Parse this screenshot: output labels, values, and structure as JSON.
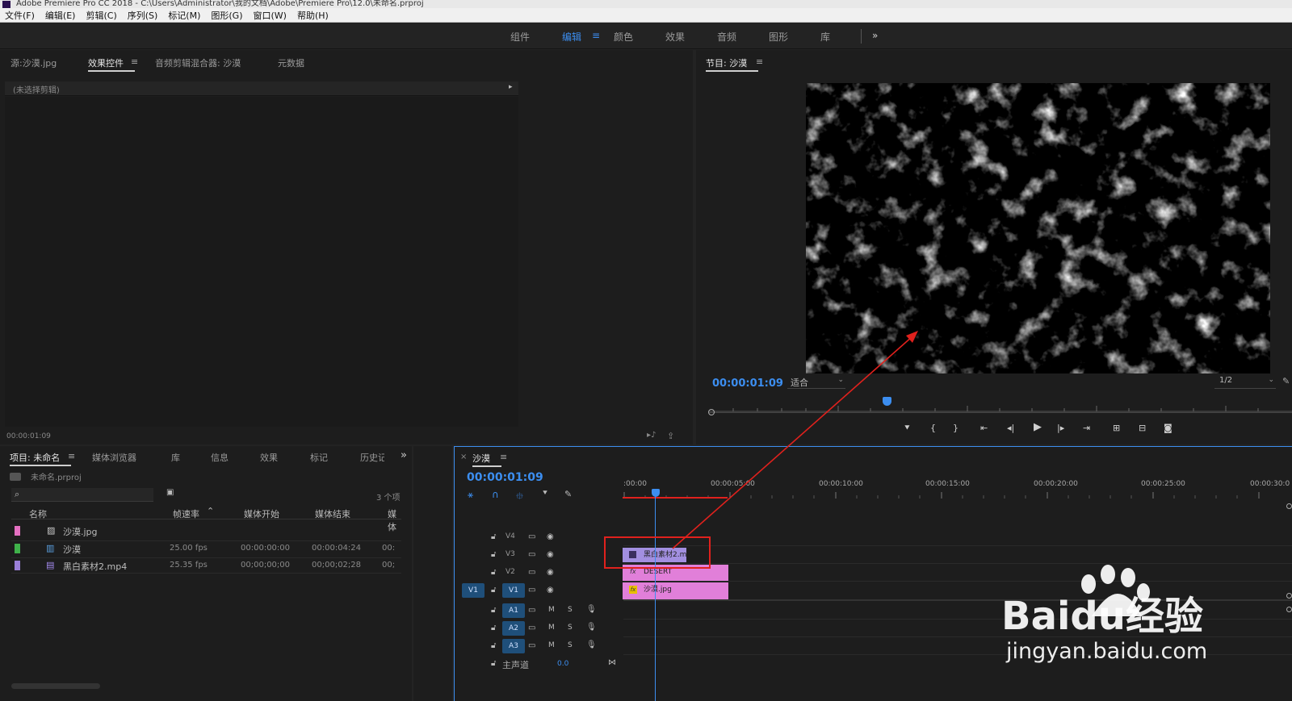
{
  "window": {
    "title": "Adobe Premiere Pro CC 2018 - C:\\Users\\Administrator\\我的文档\\Adobe\\Premiere Pro\\12.0\\未命名.prproj"
  },
  "menu": [
    "文件(F)",
    "编辑(E)",
    "剪辑(C)",
    "序列(S)",
    "标记(M)",
    "图形(G)",
    "窗口(W)",
    "帮助(H)"
  ],
  "workspaces": {
    "items": [
      "组件",
      "编辑",
      "颜色",
      "效果",
      "音频",
      "图形",
      "库"
    ],
    "active": "编辑",
    "more": "»"
  },
  "source_panel": {
    "tabs": [
      "源:沙漠.jpg",
      "效果控件",
      "音频剪辑混合器: 沙漠",
      "元数据"
    ],
    "active_tab": "效果控件",
    "no_clip": "(未选择剪辑)",
    "timecode": "00:00:01:09"
  },
  "program_monitor": {
    "title": "节目: 沙漠",
    "timecode": "00:00:01:09",
    "fit": "适合",
    "resolution": "1/2"
  },
  "project_panel": {
    "tabs": [
      "项目: 未命名",
      "媒体浏览器",
      "库",
      "信息",
      "效果",
      "标记",
      "历史记"
    ],
    "active_tab": "项目: 未命名",
    "file": "未命名.prproj",
    "search_placeholder": "",
    "count": "3 个项",
    "columns": [
      "名称",
      "帧速率",
      "媒体开始",
      "媒体结束",
      "媒体"
    ],
    "rows": [
      {
        "name": "沙漠.jpg",
        "fps": "",
        "start": "",
        "end": "",
        "more": "",
        "color": "#e36fc0",
        "icon": "image-icon"
      },
      {
        "name": "沙漠",
        "fps": "25.00 fps",
        "start": "00:00:00:00",
        "end": "00:00:04:24",
        "more": "00:",
        "color": "#3fb24a",
        "icon": "sequence-icon"
      },
      {
        "name": "黑白素材2.mp4",
        "fps": "25.35 fps",
        "start": "00;00;00;00",
        "end": "00;00;02;28",
        "more": "00;",
        "color": "#9a7fd8",
        "icon": "video-icon"
      }
    ]
  },
  "timeline": {
    "tab": "沙漠",
    "timecode": "00:00:01:09",
    "ruler": [
      ":00:00",
      "00:00:05:00",
      "00:00:10:00",
      "00:00:15:00",
      "00:00:20:00",
      "00:00:25:00",
      "00:00:30:0"
    ],
    "video_tracks": [
      "V4",
      "V3",
      "V2",
      "V1"
    ],
    "audio_tracks": [
      "A1",
      "A2",
      "A3"
    ],
    "source_v1": "V1",
    "master": "主声道",
    "master_value": "0.0",
    "clips": [
      {
        "name": "黑白素材2.m",
        "track": "V3"
      },
      {
        "name": "DESERT",
        "track": "V2"
      },
      {
        "name": "沙漠.jpg",
        "track": "V1"
      }
    ]
  },
  "watermark": {
    "brand": "Baidu经验",
    "url": "jingyan.baidu.com"
  },
  "colors": {
    "accent": "#3c8ef0",
    "clip_pink": "#e17fd9",
    "clip_purple": "#a28fe0",
    "annotation": "#e0211d"
  }
}
